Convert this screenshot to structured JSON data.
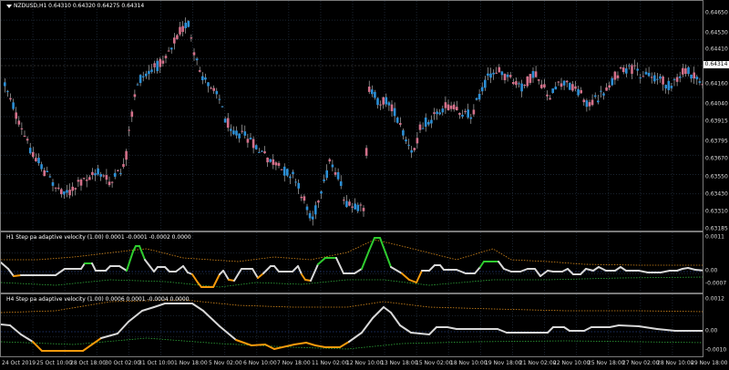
{
  "colors": {
    "background": "#000000",
    "grid": "#1b2430",
    "border": "#7a7a7a",
    "bull_candle": "#2b8fd6",
    "bear_candle": "#d4708a",
    "wick": "#c8c8c8",
    "indicator_neutral": "#d8d8d8",
    "indicator_up": "#2fcc2f",
    "indicator_down": "#f59a0c",
    "band_upper": "#d88a1c",
    "band_lower": "#2fa83a",
    "band_mid": "#3a5fc8"
  },
  "main_chart": {
    "title": "NZDUSD,H1  0.64310 0.64320 0.64275 0.64314",
    "current_price": "0.64314",
    "price_ticks": [
      "0.64650",
      "0.64530",
      "0.64410",
      "0.64314",
      "0.64160",
      "0.64040",
      "0.63915",
      "0.63795",
      "0.63670",
      "0.63550",
      "0.63430",
      "0.63310",
      "0.63185"
    ],
    "dropdown_icon": "triangle-down-icon"
  },
  "indicator_h1": {
    "title": "H1 Step pa adaptive velocity (1.00) 0.0001 -0.0001 -0.0002 0.0000",
    "ticks": [
      "0.0011",
      "0.00",
      "-0.0007"
    ]
  },
  "indicator_h4": {
    "title": "H4 Step pa adaptive velocity (1.00) 0.0006 0.0001 -0.0004 0.0000",
    "ticks": [
      "0.0012",
      "0.00",
      "-0.0010"
    ]
  },
  "time_axis": {
    "labels": [
      "24 Oct 2019",
      "25 Oct 10:00",
      "28 Oct 18:00",
      "30 Oct 02:00",
      "31 Oct 10:00",
      "1 Nov 18:00",
      "5 Nov 02:00",
      "6 Nov 10:00",
      "7 Nov 18:00",
      "11 Nov 02:00",
      "12 Nov 10:00",
      "13 Nov 18:00",
      "15 Nov 02:00",
      "18 Nov 10:00",
      "19 Nov 18:00",
      "21 Nov 02:00",
      "22 Nov 10:00",
      "25 Nov 18:00",
      "27 Nov 02:00",
      "28 Nov 10:00",
      "29 Nov 18:00"
    ]
  }
}
